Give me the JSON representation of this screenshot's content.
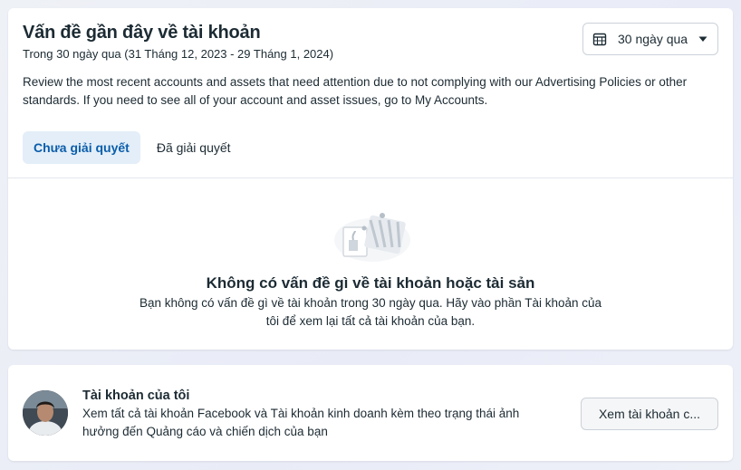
{
  "issues": {
    "title": "Vấn đề gần đây về tài khoản",
    "subtitle": "Trong 30 ngày qua (31 Tháng 12, 2023 - 29 Tháng 1, 2024)",
    "date_filter_label": "30 ngày qua",
    "description": "Review the most recent accounts and assets that need attention due to not complying with our Advertising Policies or other standards. If you need to see all of your account and asset issues, go to My Accounts.",
    "tabs": [
      {
        "label": "Chưa giải quyết",
        "active": true
      },
      {
        "label": "Đã giải quyết",
        "active": false
      }
    ],
    "empty_state": {
      "title": "Không có vấn đề gì về tài khoản hoặc tài sản",
      "body": "Bạn không có vấn đề gì về tài khoản trong 30 ngày qua. Hãy vào phần Tài khoản của tôi để xem lại tất cả tài khoản của bạn."
    }
  },
  "my_accounts": {
    "title": "Tài khoản của tôi",
    "description": "Xem tất cả tài khoản Facebook và Tài khoản kinh doanh kèm theo trạng thái ảnh hưởng đến Quảng cáo và chiến dịch của bạn",
    "button_label": "Xem tài khoản c..."
  },
  "icons": {
    "calendar": "calendar-icon",
    "dropdown": "caret-down-icon",
    "empty_illustration": "clipboard-illustration-icon",
    "avatar": "avatar"
  },
  "colors": {
    "accent": "#0a5dab",
    "active_tab_bg": "#e3eef8"
  }
}
